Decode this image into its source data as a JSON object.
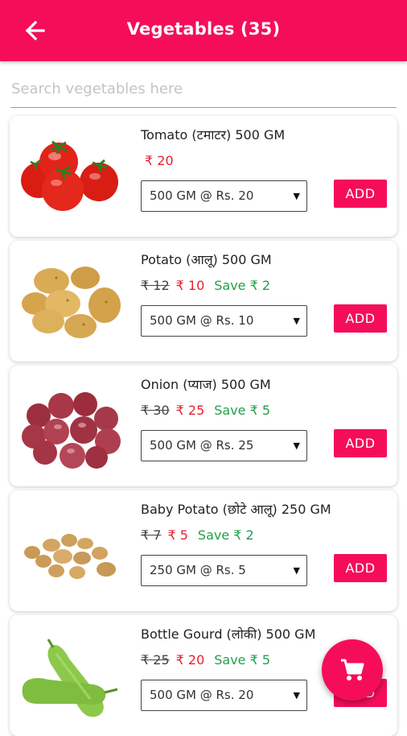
{
  "appbar": {
    "title": "Vegetables (35)",
    "color": "#f50d5a"
  },
  "search": {
    "placeholder": "Search vegetables here",
    "value": ""
  },
  "products": [
    {
      "name": "Tomato (टमाटर) 500 GM",
      "old_price": "",
      "price": "₹ 20",
      "save": "",
      "option": "500 GM @ Rs. 20",
      "add_label": "ADD",
      "image_icon": "tomato-image"
    },
    {
      "name": "Potato (आलू) 500 GM",
      "old_price": "₹ 12",
      "price": "₹ 10",
      "save": "Save ₹ 2",
      "option": "500 GM @ Rs. 10",
      "add_label": "ADD",
      "image_icon": "potato-image"
    },
    {
      "name": "Onion (प्याज) 500 GM",
      "old_price": "₹ 30",
      "price": "₹ 25",
      "save": "Save ₹ 5",
      "option": "500 GM @ Rs. 25",
      "add_label": "ADD",
      "image_icon": "onion-image"
    },
    {
      "name": "Baby Potato (छोटे आलू) 250 GM",
      "old_price": "₹ 7",
      "price": "₹ 5",
      "save": "Save ₹ 2",
      "option": "250 GM @ Rs. 5",
      "add_label": "ADD",
      "image_icon": "baby-potato-image"
    },
    {
      "name": "Bottle Gourd (लोकी) 500 GM",
      "old_price": "₹ 25",
      "price": "₹ 20",
      "save": "Save ₹ 5",
      "option": "500 GM @ Rs. 20",
      "add_label": "ADD",
      "image_icon": "bottle-gourd-image"
    }
  ],
  "fab": {
    "icon": "cart-icon"
  },
  "colors": {
    "accent": "#f50d5a",
    "price_red": "#e8202f",
    "save_green": "#22a04a"
  }
}
